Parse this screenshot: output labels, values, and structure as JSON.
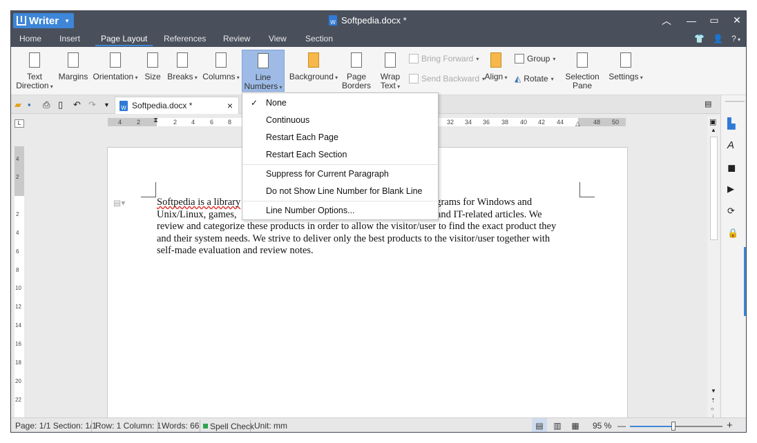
{
  "app": {
    "name": "Writer",
    "doc_title": "Softpedia.docx *"
  },
  "window_controls": {
    "collapse": "︿",
    "minimize": "—",
    "maximize": "▭",
    "close": "✕"
  },
  "menubar": [
    "Home",
    "Insert",
    "Page Layout",
    "References",
    "Review",
    "View",
    "Section"
  ],
  "menubar_right": {
    "help": "?"
  },
  "ribbon": {
    "text_direction": "Text\nDirection",
    "margins": "Margins",
    "orientation": "Orientation",
    "size": "Size",
    "breaks": "Breaks",
    "columns": "Columns",
    "line_numbers": "Line\nNumbers",
    "background": "Background",
    "page_borders": "Page\nBorders",
    "wrap_text": "Wrap\nText",
    "bring_forward": "Bring Forward",
    "send_backward": "Send Backward",
    "align": "Align",
    "group": "Group",
    "rotate": "Rotate",
    "selection_pane": "Selection\nPane",
    "settings": "Settings"
  },
  "doc_tab": {
    "name": "Softpedia.docx *",
    "close": "×"
  },
  "ruler_h": [
    "4",
    "2",
    "2",
    "4",
    "6",
    "8",
    "32",
    "34",
    "36",
    "38",
    "40",
    "42",
    "44",
    "48",
    "50"
  ],
  "ruler_v": [
    "4",
    "2",
    "2",
    "4",
    "6",
    "8",
    "10",
    "12",
    "14",
    "16",
    "18",
    "20",
    "22"
  ],
  "document": {
    "paragraph": "Softpedia is a library of over 1,300,000 free and free-to-try software programs for Windows and Unix/Linux, games, Mac software, Windows drivers, mobile devices and IT-related articles. We review and categorize these products in order to allow the visitor/user to find the exact product they and their system needs. We strive to deliver only the best products to the visitor/user together with self-made evaluation and review notes.",
    "line1": "Softpedia is a library",
    "line1b": "e programs for Windows and",
    "line2": "Unix/Linux, games,",
    "line2b": "es and IT-related articles. We",
    "line3": "review and categorize these products in order to allow the visitor/user to find the exact product they",
    "line4": "and their system needs. We strive to deliver only the best products to the visitor/user together with",
    "line5": "self-made evaluation and review notes."
  },
  "dropdown": {
    "items": [
      "None",
      "Continuous",
      "Restart Each Page",
      "Restart Each Section",
      "Suppress for Current Paragraph",
      "Do not Show Line Number for Blank Line",
      "Line Number Options..."
    ],
    "checked": "None"
  },
  "status": {
    "page": "Page: 1/1 Section: 1/1",
    "row": "Row: 1 Column: 1",
    "words": "Words: 66",
    "spell": "Spell Check",
    "unit": "Unit: mm",
    "zoom": "95 %",
    "zoom_minus": "—",
    "zoom_plus": "+"
  },
  "colors": {
    "titlebar": "#49505c",
    "accent": "#3d86d8",
    "active_ribbon": "#9dbbe6"
  }
}
